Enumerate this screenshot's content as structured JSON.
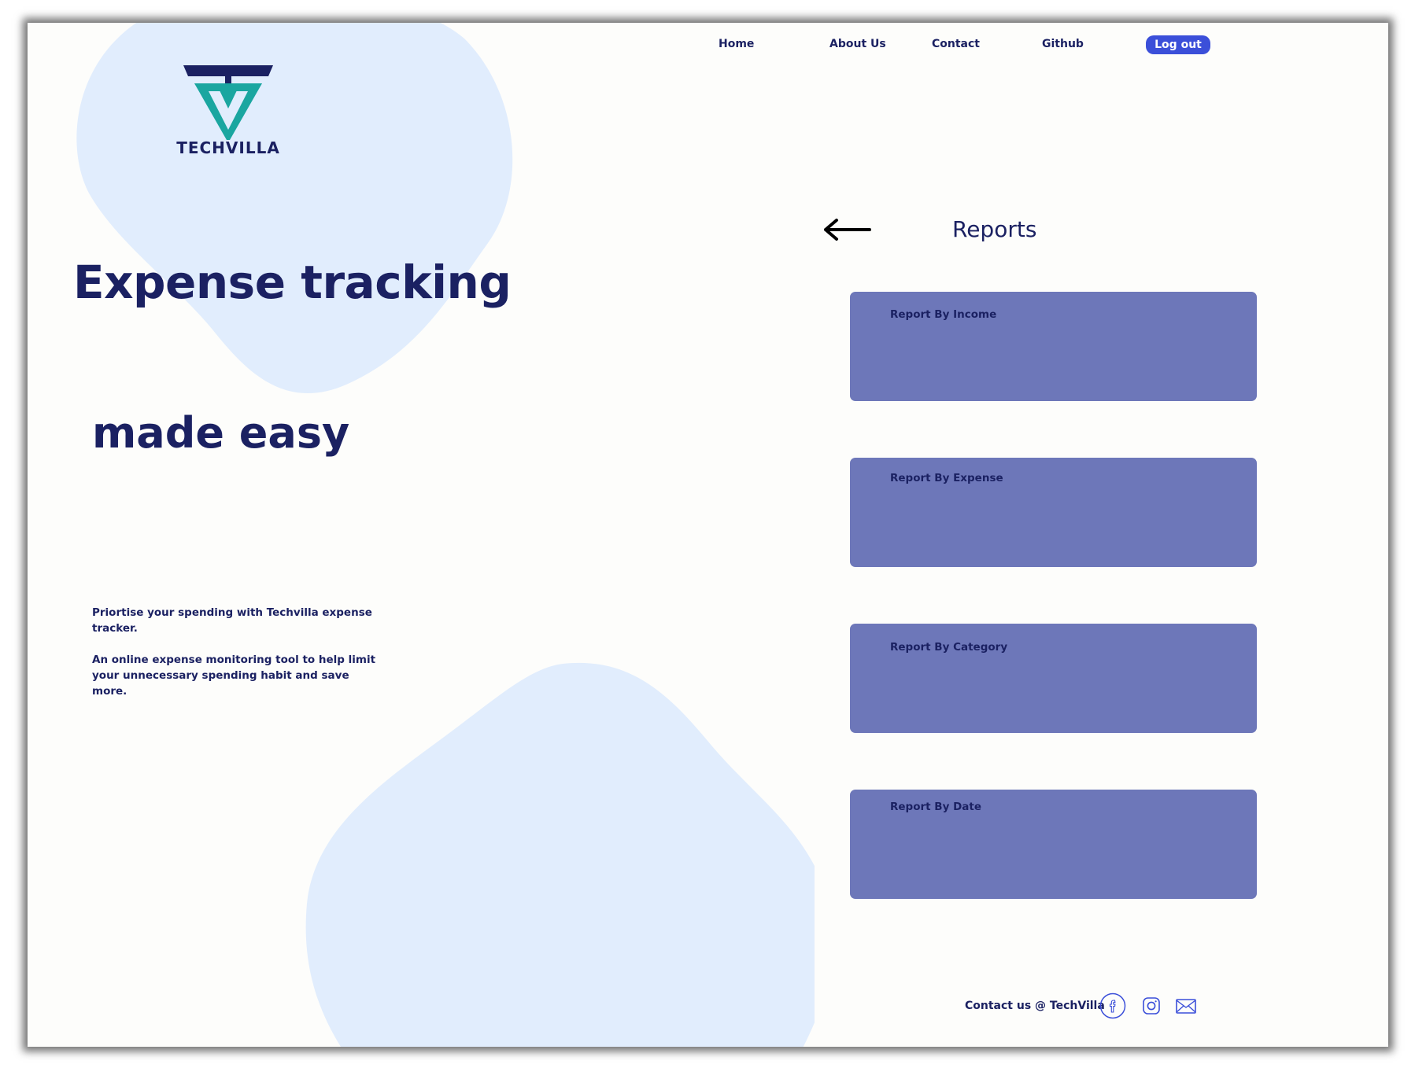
{
  "brand": {
    "logo_text": "TECHVILLA"
  },
  "nav": {
    "items": [
      {
        "label": "Home"
      },
      {
        "label": "About Us"
      },
      {
        "label": "Contact"
      },
      {
        "label": "Github"
      }
    ],
    "logout_label": "Log out"
  },
  "hero": {
    "line1": "Expense tracking",
    "line2": "made easy",
    "desc1": "Priortise your spending with Techvilla expense tracker.",
    "desc2": "An online expense monitoring tool to help limit your unnecessary spending habit and save more."
  },
  "reports": {
    "title": "Reports",
    "items": [
      {
        "label": "Report By Income"
      },
      {
        "label": "Report By Expense"
      },
      {
        "label": "Report By Category"
      },
      {
        "label": "Report By Date"
      }
    ]
  },
  "footer": {
    "contact_prefix": "Contact us @ ",
    "contact_brand": "TechVilla",
    "icons": [
      "facebook-icon",
      "instagram-icon",
      "mail-icon"
    ]
  },
  "colors": {
    "navy": "#1b2162",
    "teal": "#1aa6a0",
    "card": "#6d77b9",
    "blob": "#e1edfd",
    "button": "#3b4fd9",
    "background": "#fdfdfb"
  }
}
